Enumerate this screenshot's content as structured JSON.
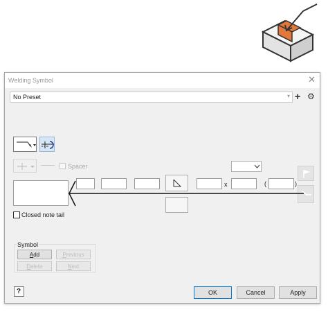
{
  "window": {
    "title": "Welding Symbol"
  },
  "preset": {
    "value": "No Preset"
  },
  "labels": {
    "spacer": "Spacer",
    "closed_note_tail": "Closed note tail",
    "x_separator": "x",
    "paren_open": "(",
    "paren_close": ")"
  },
  "symbol_group": {
    "title": "Symbol",
    "add": "Add",
    "add_mnemonic": "A",
    "previous": "Previous",
    "previous_mnemonic": "P",
    "delete": "Delete",
    "delete_mnemonic": "D",
    "next": "Next",
    "next_mnemonic": "N"
  },
  "footer": {
    "ok": "OK",
    "cancel": "Cancel",
    "apply": "Apply"
  },
  "icons": {
    "corner": "weld-feature-icon",
    "close": "close-icon",
    "add_preset": "plus-icon",
    "settings": "gear-icon",
    "leader": "leader-arrow-icon",
    "identification_line": "identification-line-icon",
    "other_side": "other-side-symbol-icon",
    "weld_symbol": "fillet-weld-icon",
    "flag": "flag-icon",
    "help": "help-icon"
  },
  "colors": {
    "accent": "#0078d7",
    "weld_orange": "#e2783a"
  }
}
